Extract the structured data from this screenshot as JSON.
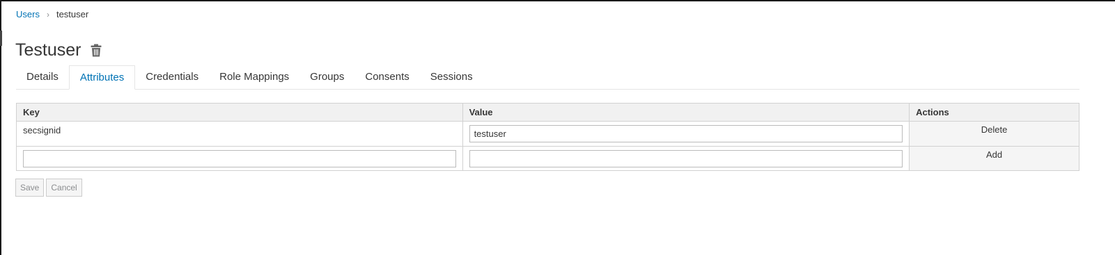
{
  "breadcrumb": {
    "parent": "Users",
    "separator": "›",
    "current": "testuser"
  },
  "page": {
    "title": "Testuser",
    "delete_icon": "trash-icon"
  },
  "tabs": [
    {
      "label": "Details",
      "active": false
    },
    {
      "label": "Attributes",
      "active": true
    },
    {
      "label": "Credentials",
      "active": false
    },
    {
      "label": "Role Mappings",
      "active": false
    },
    {
      "label": "Groups",
      "active": false
    },
    {
      "label": "Consents",
      "active": false
    },
    {
      "label": "Sessions",
      "active": false
    }
  ],
  "table": {
    "headers": {
      "key": "Key",
      "value": "Value",
      "actions": "Actions"
    },
    "rows": [
      {
        "key": "secsignid",
        "value": "testuser",
        "action": "Delete"
      }
    ],
    "new_row": {
      "key": "",
      "value": "",
      "action": "Add"
    }
  },
  "buttons": {
    "save": "Save",
    "cancel": "Cancel"
  },
  "colors": {
    "link": "#0073b5",
    "text": "#363636",
    "header_bg": "#f1f1f1",
    "border": "#d1d1d1"
  }
}
